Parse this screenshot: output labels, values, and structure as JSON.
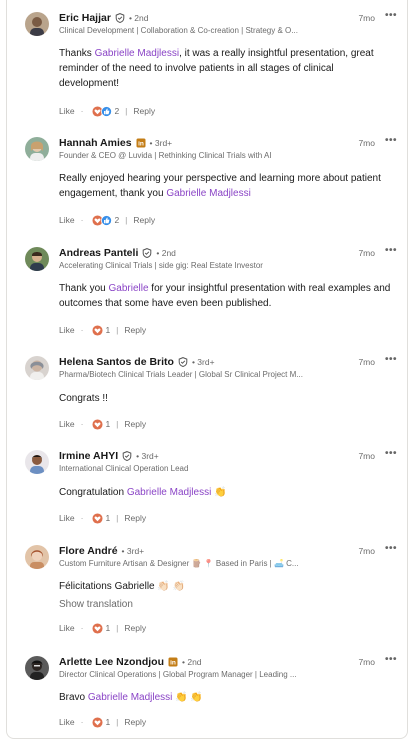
{
  "ui": {
    "more_label": "•••",
    "like_label": "Like",
    "reply_label": "Reply",
    "show_translation": "Show translation"
  },
  "colors": {
    "mention": "#8a44c6",
    "linkedin_blue": "#0a66c2",
    "premium_gold": "#c37d16"
  },
  "comments": [
    {
      "name": "Eric Hajjar",
      "badge": "verified-icon",
      "degree": "• 2nd",
      "tagline": "Clinical Development | Collaboration & Co-creation | Strategy & O...",
      "time": "7mo",
      "text": [
        {
          "t": "Thanks "
        },
        {
          "t": "Gabrielle Madjlessi",
          "m": true
        },
        {
          "t": ", it was a really insightful presentation, great reminder of the need to involve patients in all stages of clinical development!"
        }
      ],
      "reactions": "2",
      "reaction_icons": [
        "heart-icon",
        "like-icon"
      ]
    },
    {
      "name": "Hannah Amies",
      "badge": "premium-icon",
      "degree": "• 3rd+",
      "tagline": "Founder & CEO @ Luvida | Rethinking Clinical Trials with AI",
      "time": "7mo",
      "text": [
        {
          "t": "Really enjoyed hearing your perspective and learning more about patient engagement, thank you "
        },
        {
          "t": "Gabrielle Madjlessi",
          "m": true
        }
      ],
      "reactions": "2",
      "reaction_icons": [
        "heart-icon",
        "like-icon"
      ]
    },
    {
      "name": "Andreas Panteli",
      "badge": "verified-icon",
      "degree": "• 2nd",
      "tagline": "Accelerating Clinical Trials | side gig: Real Estate Investor",
      "time": "7mo",
      "text": [
        {
          "t": "Thank you "
        },
        {
          "t": "Gabrielle",
          "m": true
        },
        {
          "t": " for your insightful presentation with real examples and outcomes that some have even been published."
        }
      ],
      "reactions": "1",
      "reaction_icons": [
        "heart-icon"
      ]
    },
    {
      "name": "Helena Santos de Brito",
      "badge": "verified-icon",
      "degree": "• 3rd+",
      "tagline": "Pharma/Biotech Clinical Trials Leader | Global Sr Clinical Project M...",
      "time": "7mo",
      "text": [
        {
          "t": "Congrats !!"
        }
      ],
      "reactions": "1",
      "reaction_icons": [
        "heart-icon"
      ]
    },
    {
      "name": "Irmine AHYI",
      "badge": "verified-icon",
      "degree": "• 3rd+",
      "tagline": "International Clinical Operation Lead",
      "time": "7mo",
      "text": [
        {
          "t": "Congratulation "
        },
        {
          "t": "Gabrielle Madjlessi",
          "m": true
        },
        {
          "t": " 👏"
        }
      ],
      "reactions": "1",
      "reaction_icons": [
        "heart-icon"
      ]
    },
    {
      "name": "Flore André",
      "badge": "",
      "degree": "• 3rd+",
      "tagline": "Custom Furniture Artisan & Designer 🪵 📍 Based in Paris | 🛋️ C...",
      "time": "7mo",
      "text": [
        {
          "t": "Félicitations Gabrielle 👏🏻 👏🏻"
        }
      ],
      "show_translation": true,
      "reactions": "1",
      "reaction_icons": [
        "heart-icon"
      ]
    },
    {
      "name": "Arlette Lee Nzondjou",
      "badge": "premium-icon",
      "degree": "• 2nd",
      "tagline": "Director Clinical Operations | Global Program Manager | Leading ...",
      "time": "7mo",
      "text": [
        {
          "t": "Bravo "
        },
        {
          "t": "Gabrielle Madjlessi",
          "m": true
        },
        {
          "t": " 👏 👏"
        }
      ],
      "reactions": "1",
      "reaction_icons": [
        "heart-icon"
      ]
    }
  ]
}
